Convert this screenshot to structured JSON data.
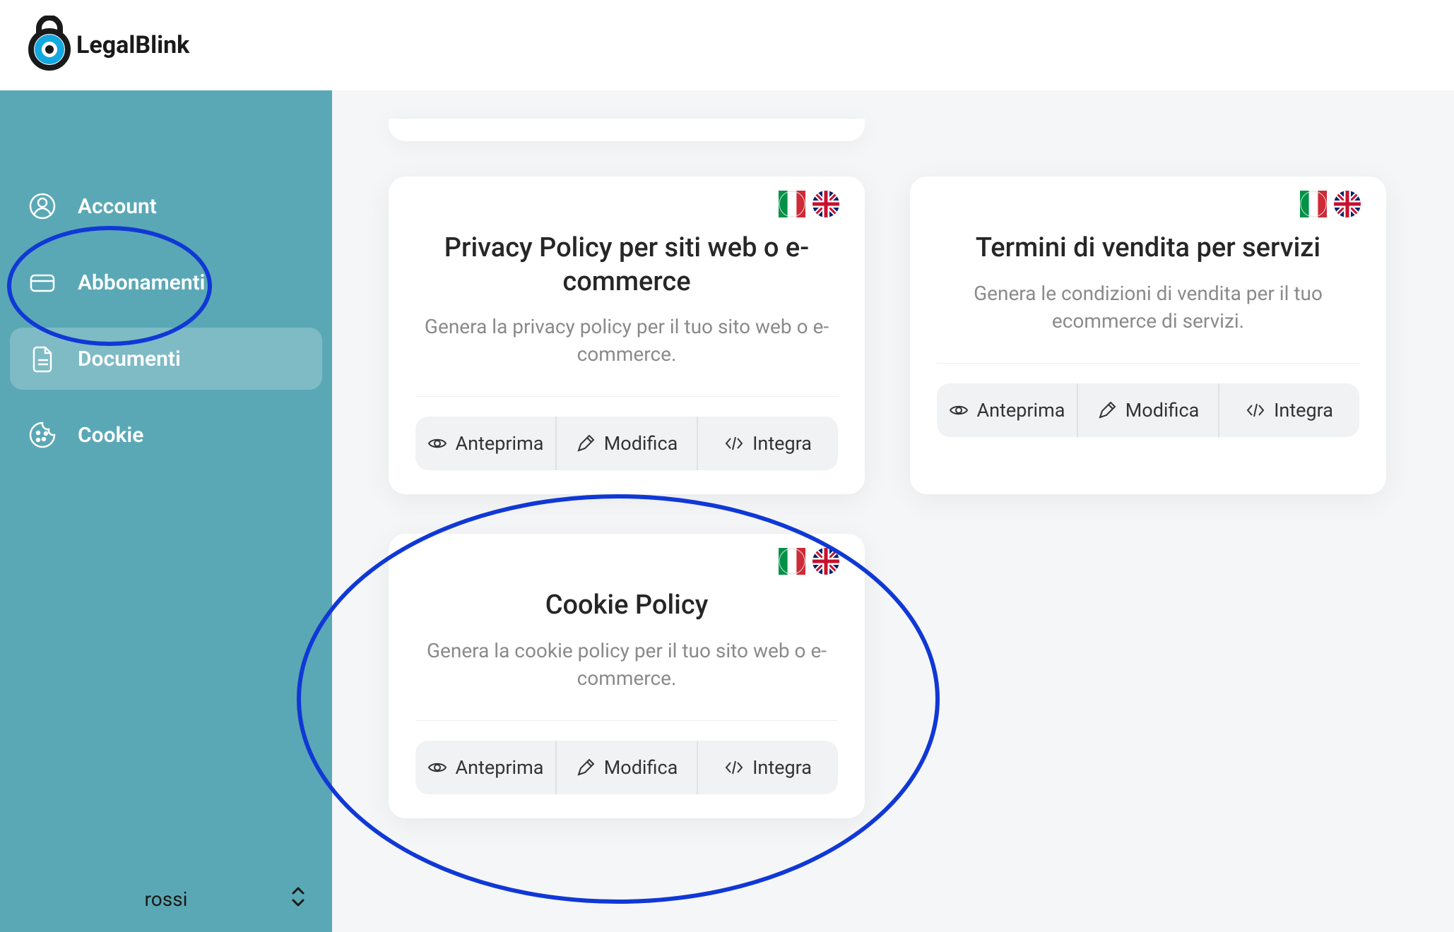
{
  "brand": {
    "name": "LegalBlink"
  },
  "sidebar": {
    "items": [
      {
        "label": "Account"
      },
      {
        "label": "Abbonamenti"
      },
      {
        "label": "Documenti"
      },
      {
        "label": "Cookie"
      }
    ],
    "footer_user": "rossi"
  },
  "actions": {
    "preview": "Anteprima",
    "edit": "Modifica",
    "integrate": "Integra"
  },
  "cards": [
    {
      "title": "Privacy Policy per siti web o e-commerce",
      "desc": "Genera la privacy policy per il tuo sito web o e-commerce."
    },
    {
      "title": "Termini di vendita per servizi",
      "desc": "Genera le condizioni di vendita per il tuo ecommerce di servizi."
    },
    {
      "title": "Cookie Policy",
      "desc": "Genera la cookie policy per il tuo sito web o e-commerce."
    }
  ]
}
